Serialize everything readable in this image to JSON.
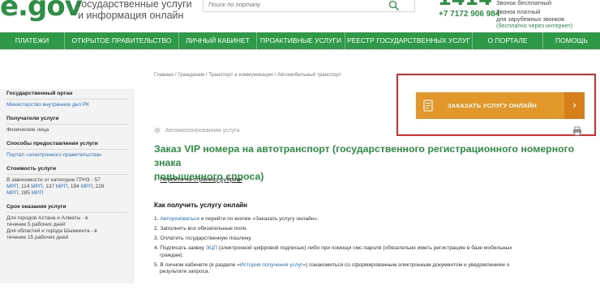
{
  "header": {
    "logo": "e.gov",
    "tagline_1": "государственные услуги",
    "tagline_2": "и информация онлайн",
    "search_placeholder": "Поиск по порталу",
    "call_center": "1414",
    "free_call": "Звонок бесплатный",
    "phone_main": "+7 7172 906 984",
    "paid_call": "Звонок платный",
    "foreign_calls": "для зарубежных звонков",
    "free_internet": "(бесплатно через интернет)"
  },
  "nav": {
    "items": [
      "ПЛАТЕЖИ",
      "ОТКРЫТОЕ ПРАВИТЕЛЬСТВО",
      "ЛИЧНЫЙ КАБИНЕТ",
      "ПРОАКТИВНЫЕ УСЛУГИ",
      "РЕЕСТР ГОСУДАРСТВЕННЫХ УСЛУГ",
      "О ПОРТАЛЕ",
      "ПОМОЩЬ"
    ]
  },
  "sidebar": {
    "gov_body_title": "Государственный орган",
    "gov_body": "Министерство внутренних дел РК",
    "recipients_title": "Получатели услуги",
    "recipients": "Физические лица",
    "methods_title": "Способы предоставления услуги",
    "methods": "Портал «электронного правительства»",
    "cost_title": "Стоимость услуги",
    "cost_prefix": "В зависимости от категории ГРНЗ - 57",
    "cost_line_2": [
      {
        "text": "МРП",
        "link": true
      },
      {
        "text": ", 114 ",
        "link": false
      },
      {
        "text": "МРП",
        "link": true
      },
      {
        "text": ", 137 ",
        "link": false
      },
      {
        "text": "МРП",
        "link": true
      },
      {
        "text": ", 194 ",
        "link": false
      },
      {
        "text": "МРП",
        "link": true
      },
      {
        "text": ", 228",
        "link": false
      }
    ],
    "cost_line_3": [
      {
        "text": "МРП",
        "link": true
      },
      {
        "text": ", 285 ",
        "link": false
      },
      {
        "text": "МРП",
        "link": true
      }
    ],
    "term_title": "Срок оказания услуги",
    "term_1a": "Для городов Астана и Алматы - в",
    "term_1b": "течение 5 рабочих дней",
    "term_2a": "Для областей и города Шымкента - в",
    "term_2b": "течение 15 рабочих дней"
  },
  "main": {
    "breadcrumb": "Главная / Гражданам / Транспорт и коммуникации / Автомобильный транспорт",
    "order_button": "ЗАКАЗАТЬ УСЛУГУ ОНЛАЙН",
    "auto_service": "Автоматизированная услуга",
    "title_line_1": "Заказ VIP номера на автотранспорт (государственного регистрационного номерного знака",
    "title_line_2": "повышенного спроса)",
    "back_link": "Перейти на страницу рубрики",
    "howto_title": "Как получить услугу онлайн",
    "step1": {
      "num": "1. ",
      "link": "Авторизоваться",
      "rest": " и перейти по кнопке «Заказать услугу онлайн»."
    },
    "step2": "2. Заполнить все обязательные поля.",
    "step3": "3. Оплатить государственную пошлину.",
    "step4": {
      "pre": "4. Подписать заявку ",
      "link": "ЭЦП",
      "rest": " (электронной цифровой подписью) либо при помощи смс-пароля (обязательно иметь регистрацию в базе мобильных",
      "line2": "граждан)."
    },
    "step5": {
      "pre": "5. В личном кабинете (в разделе «",
      "link": "История получения услуг",
      "rest": "») ознакомиться со сформированным электронным документом и уведомлением о",
      "line2": "результате запроса."
    }
  },
  "colors": {
    "brand_green": "#2c8f43",
    "nav_green": "#2e9a47",
    "order_orange": "#e2972a",
    "highlight_red": "#e02a2a",
    "link_blue": "#2a6ebb"
  }
}
